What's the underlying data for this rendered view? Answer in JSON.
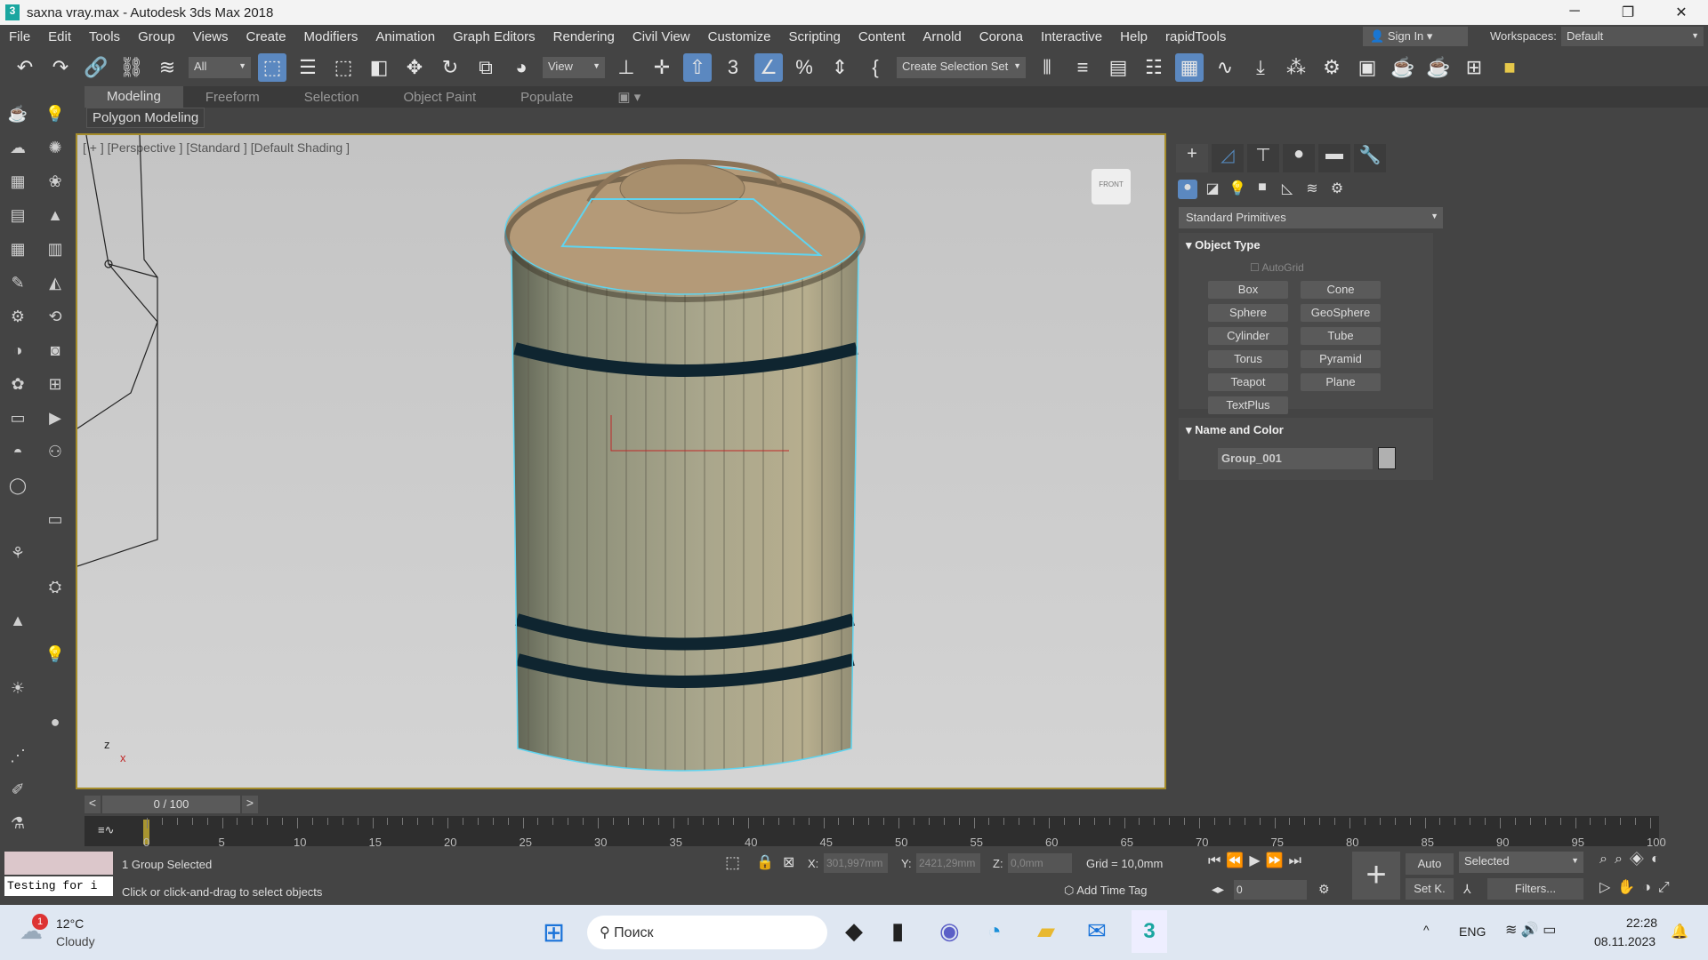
{
  "window": {
    "title": "saxna vray.max - Autodesk 3ds Max 2018",
    "controls": [
      "─",
      "❐",
      "✕"
    ]
  },
  "menu": [
    "File",
    "Edit",
    "Tools",
    "Group",
    "Views",
    "Create",
    "Modifiers",
    "Animation",
    "Graph Editors",
    "Rendering",
    "Civil View",
    "Customize",
    "Scripting",
    "Content",
    "Arnold",
    "Corona",
    "Interactive",
    "Help",
    "rapidTools"
  ],
  "account": {
    "sign_in": "Sign In",
    "workspaces_label": "Workspaces:",
    "workspace": "Default"
  },
  "toolbar": {
    "filter": "All",
    "ref_coord": "View",
    "selection_set": "Create Selection Set"
  },
  "ribbon": {
    "tabs": [
      "Modeling",
      "Freeform",
      "Selection",
      "Object Paint",
      "Populate"
    ],
    "panel": "Polygon Modeling"
  },
  "viewport": {
    "label": "[ + ] [Perspective ] [Standard ] [Default Shading ]",
    "viewcube": "FRONT"
  },
  "command_panel": {
    "category": "Standard Primitives",
    "object_type": "Object Type",
    "autogrid": "AutoGrid",
    "buttons": [
      "Box",
      "Cone",
      "Sphere",
      "GeoSphere",
      "Cylinder",
      "Tube",
      "Torus",
      "Pyramid",
      "Teapot",
      "Plane",
      "TextPlus"
    ],
    "name_color": "Name and Color",
    "object_name": "Group_001"
  },
  "timeline": {
    "frame": "0 / 100",
    "ticks": [
      "0",
      "5",
      "10",
      "15",
      "20",
      "25",
      "30",
      "35",
      "40",
      "45",
      "50",
      "55",
      "60",
      "65",
      "70",
      "75",
      "80",
      "85",
      "90",
      "95",
      "100"
    ]
  },
  "status": {
    "maxscript": "Testing for i",
    "selected": "1 Group Selected",
    "prompt": "Click or click-and-drag to select objects",
    "x": "301,997mm",
    "y": "2421,29mm",
    "z": "0,0mm",
    "grid": "Grid = 10,0mm",
    "add_time_tag": "Add Time Tag",
    "auto": "Auto",
    "set_key": "Set K.",
    "key_filter": "Selected",
    "filters": "Filters...",
    "frame": "0",
    "x_label": "X:",
    "y_label": "Y:",
    "z_label": "Z:"
  },
  "taskbar": {
    "temp": "12°C",
    "weather": "Cloudy",
    "badge": "1",
    "search": "Поиск",
    "lang": "ENG",
    "time": "22:28",
    "date": "08.11.2023"
  }
}
